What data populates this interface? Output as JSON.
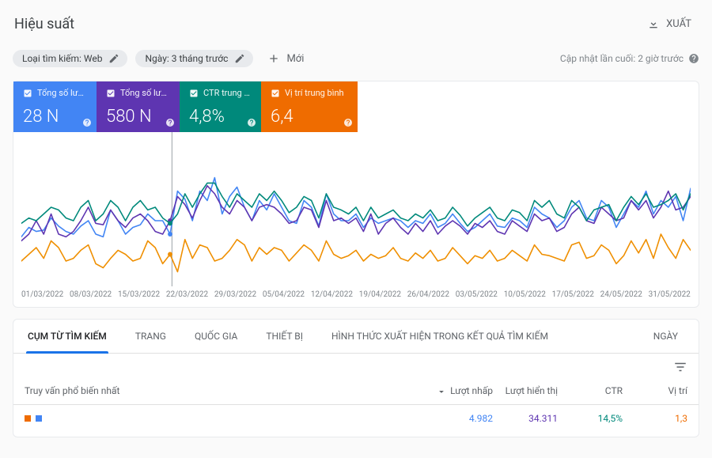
{
  "header": {
    "title": "Hiệu suất",
    "export": "XUẤT"
  },
  "filters": {
    "chip_type_label": "Loại tìm kiếm: Web",
    "chip_date_label": "Ngày: 3 tháng trước",
    "add_new": "Mới",
    "updated": "Cập nhật lần cuối: 2 giờ trước"
  },
  "metrics": [
    {
      "label": "Tổng số lượt nh...",
      "value": "28 N"
    },
    {
      "label": "Tổng số lượt hiể...",
      "value": "580 N"
    },
    {
      "label": "CTR trung bình",
      "value": "4,8%"
    },
    {
      "label": "Vị trí trung bình",
      "value": "6,4"
    }
  ],
  "chart_data": {
    "type": "line",
    "x_labels": [
      "01/03/2022",
      "08/03/2022",
      "15/03/2022",
      "22/03/2022",
      "29/03/2022",
      "05/04/2022",
      "12/04/2022",
      "19/04/2022",
      "26/04/2022",
      "03/05/2022",
      "10/05/2022",
      "17/05/2022",
      "24/05/2022",
      "31/05/2022"
    ],
    "ylim": [
      0,
      1
    ],
    "note": "Axes have no numeric tick labels; values are normalized 0-1 for shape only.",
    "series": [
      {
        "name": "clicks",
        "color": "#4285f4",
        "values": [
          0.28,
          0.35,
          0.32,
          0.33,
          0.42,
          0.36,
          0.32,
          0.3,
          0.36,
          0.4,
          0.3,
          0.28,
          0.48,
          0.4,
          0.3,
          0.35,
          0.37,
          0.45,
          0.4,
          0.4,
          0.3,
          0.62,
          0.56,
          0.4,
          0.62,
          0.55,
          0.72,
          0.45,
          0.58,
          0.65,
          0.5,
          0.4,
          0.55,
          0.48,
          0.6,
          0.5,
          0.4,
          0.38,
          0.55,
          0.5,
          0.36,
          0.6,
          0.45,
          0.4,
          0.4,
          0.45,
          0.35,
          0.42,
          0.38,
          0.4,
          0.42,
          0.4,
          0.35,
          0.4,
          0.38,
          0.45,
          0.35,
          0.38,
          0.45,
          0.38,
          0.32,
          0.35,
          0.4,
          0.45,
          0.36,
          0.35,
          0.42,
          0.4,
          0.35,
          0.5,
          0.45,
          0.42,
          0.35,
          0.4,
          0.5,
          0.55,
          0.42,
          0.4,
          0.55,
          0.5,
          0.35,
          0.45,
          0.55,
          0.5,
          0.62,
          0.45,
          0.55,
          0.5,
          0.58,
          0.4,
          0.64
        ]
      },
      {
        "name": "impressions",
        "color": "#5e35b1",
        "values": [
          0.25,
          0.3,
          0.4,
          0.3,
          0.45,
          0.3,
          0.28,
          0.32,
          0.4,
          0.5,
          0.38,
          0.37,
          0.48,
          0.4,
          0.35,
          0.42,
          0.45,
          0.4,
          0.32,
          0.3,
          0.4,
          0.58,
          0.52,
          0.42,
          0.55,
          0.66,
          0.6,
          0.5,
          0.45,
          0.55,
          0.5,
          0.4,
          0.5,
          0.52,
          0.5,
          0.45,
          0.38,
          0.4,
          0.5,
          0.48,
          0.35,
          0.55,
          0.4,
          0.42,
          0.38,
          0.42,
          0.32,
          0.45,
          0.3,
          0.38,
          0.42,
          0.35,
          0.3,
          0.38,
          0.32,
          0.4,
          0.3,
          0.36,
          0.4,
          0.36,
          0.3,
          0.38,
          0.35,
          0.4,
          0.32,
          0.3,
          0.4,
          0.36,
          0.32,
          0.45,
          0.4,
          0.42,
          0.32,
          0.35,
          0.45,
          0.5,
          0.4,
          0.38,
          0.5,
          0.45,
          0.4,
          0.42,
          0.55,
          0.48,
          0.55,
          0.42,
          0.5,
          0.62,
          0.48,
          0.5,
          0.58
        ]
      },
      {
        "name": "ctr",
        "color": "#00897b",
        "values": [
          0.38,
          0.42,
          0.4,
          0.45,
          0.5,
          0.48,
          0.42,
          0.4,
          0.5,
          0.55,
          0.4,
          0.45,
          0.55,
          0.5,
          0.4,
          0.5,
          0.55,
          0.48,
          0.5,
          0.42,
          0.38,
          0.45,
          0.6,
          0.5,
          0.6,
          0.68,
          0.68,
          0.58,
          0.5,
          0.6,
          0.55,
          0.5,
          0.6,
          0.55,
          0.62,
          0.55,
          0.46,
          0.5,
          0.58,
          0.55,
          0.42,
          0.6,
          0.5,
          0.48,
          0.45,
          0.5,
          0.4,
          0.5,
          0.42,
          0.45,
          0.48,
          0.42,
          0.4,
          0.45,
          0.42,
          0.48,
          0.4,
          0.42,
          0.5,
          0.44,
          0.36,
          0.42,
          0.46,
          0.5,
          0.42,
          0.4,
          0.48,
          0.46,
          0.4,
          0.55,
          0.5,
          0.55,
          0.45,
          0.42,
          0.55,
          0.5,
          0.4,
          0.48,
          0.5,
          0.52,
          0.4,
          0.5,
          0.58,
          0.52,
          0.6,
          0.5,
          0.52,
          0.55,
          0.6,
          0.48,
          0.6
        ]
      },
      {
        "name": "position",
        "color": "#ef8f00",
        "values": [
          0.1,
          0.15,
          0.2,
          0.12,
          0.25,
          0.2,
          0.1,
          0.12,
          0.18,
          0.22,
          0.08,
          0.05,
          0.12,
          0.18,
          0.15,
          0.1,
          0.12,
          0.25,
          0.2,
          0.08,
          0.15,
          0.02,
          0.26,
          0.12,
          0.22,
          0.2,
          0.1,
          0.12,
          0.18,
          0.26,
          0.22,
          0.1,
          0.2,
          0.15,
          0.2,
          0.18,
          0.1,
          0.16,
          0.22,
          0.18,
          0.1,
          0.25,
          0.15,
          0.12,
          0.14,
          0.18,
          0.1,
          0.15,
          0.12,
          0.14,
          0.2,
          0.12,
          0.1,
          0.16,
          0.12,
          0.18,
          0.1,
          0.12,
          0.2,
          0.14,
          0.08,
          0.14,
          0.12,
          0.18,
          0.1,
          0.12,
          0.18,
          0.14,
          0.1,
          0.22,
          0.15,
          0.14,
          0.12,
          0.1,
          0.22,
          0.24,
          0.12,
          0.14,
          0.22,
          0.18,
          0.08,
          0.14,
          0.25,
          0.16,
          0.26,
          0.12,
          0.3,
          0.2,
          0.12,
          0.26,
          0.18
        ]
      }
    ]
  },
  "tabs": {
    "items": [
      "CỤM TỪ TÌM KIẾM",
      "TRANG",
      "QUỐC GIA",
      "THIẾT BỊ",
      "HÌNH THỨC XUẤT HIỆN TRONG KẾT QUẢ TÌM KIẾM",
      "NGÀY"
    ],
    "active_index": 0
  },
  "table": {
    "headers": {
      "query": "Truy vấn phổ biến nhất",
      "clicks": "Lượt nhấp",
      "impressions": "Lượt hiển thị",
      "ctr": "CTR",
      "position": "Vị trí"
    },
    "row": {
      "clicks": "4.982",
      "impressions": "34.311",
      "ctr": "14,5%",
      "position": "1,3"
    }
  }
}
